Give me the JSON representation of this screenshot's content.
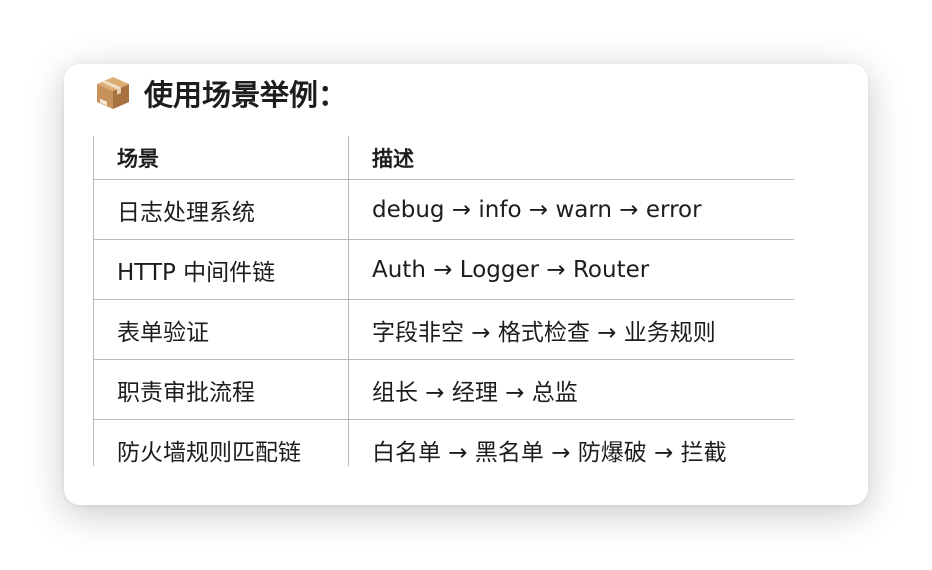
{
  "section": {
    "icon": "package-icon",
    "title": "使用场景举例："
  },
  "table": {
    "headers": [
      "场景",
      "描述"
    ],
    "rows": [
      [
        "日志处理系统",
        "debug → info → warn → error"
      ],
      [
        "HTTP 中间件链",
        "Auth → Logger → Router"
      ],
      [
        "表单验证",
        "字段非空 → 格式检查 → 业务规则"
      ],
      [
        "职责审批流程",
        "组长 → 经理 → 总监"
      ],
      [
        "防火墙规则匹配链",
        "白名单 → 黑名单 → 防爆破 → 拦截"
      ]
    ]
  },
  "colors": {
    "border": "#b8b8bc",
    "text": "#1d1d1f",
    "box_front": "#c8935a",
    "box_top": "#dcae76",
    "box_side": "#a87240"
  }
}
